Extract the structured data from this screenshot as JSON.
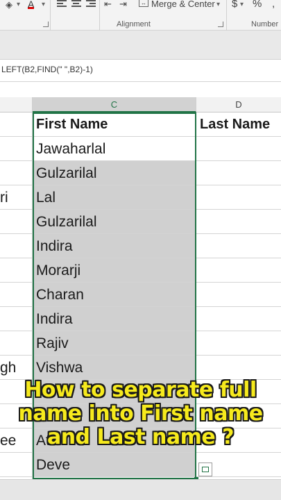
{
  "ribbon": {
    "merge_center_label": "Merge & Center",
    "currency_symbol": "$",
    "percent_symbol": "%",
    "font_color_letter": "A",
    "alignment_group": "Alignment",
    "number_group": "Number"
  },
  "formula_bar": {
    "formula": "LEFT(B2,FIND(\" \",B2)-1)"
  },
  "columns": {
    "c": "C",
    "d": "D"
  },
  "header_row": {
    "c": "First Name",
    "d": "Last Name"
  },
  "rows": [
    {
      "b": "",
      "c": "Jawaharlal",
      "highlight": false
    },
    {
      "b": "",
      "c": "Gulzarilal",
      "highlight": true
    },
    {
      "b": "ri",
      "c": "Lal",
      "highlight": true
    },
    {
      "b": "",
      "c": "Gulzarilal",
      "highlight": true
    },
    {
      "b": "",
      "c": "Indira",
      "highlight": true
    },
    {
      "b": "",
      "c": "Morarji",
      "highlight": true
    },
    {
      "b": "",
      "c": "Charan",
      "highlight": true
    },
    {
      "b": "",
      "c": "Indira",
      "highlight": true
    },
    {
      "b": "",
      "c": "Rajiv",
      "highlight": true
    },
    {
      "b": "gh",
      "c": "Vishwa",
      "highlight": true
    },
    {
      "b": "",
      "c": "",
      "highlight": true
    },
    {
      "b": "",
      "c": "",
      "highlight": true
    },
    {
      "b": "ee",
      "c": "Atal",
      "highlight": true
    },
    {
      "b": "",
      "c": "Deve",
      "highlight": true
    }
  ],
  "caption": {
    "line1": "How to separate full",
    "line2": "name into First name",
    "line3": "and Last name ?"
  },
  "colors": {
    "excel_green": "#217346",
    "selection_fill": "#d0d0d0",
    "caption_text": "#f6ea1d"
  }
}
